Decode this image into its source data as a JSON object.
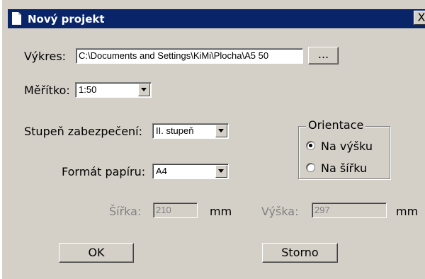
{
  "window": {
    "title": "Nový projekt",
    "close_glyph": "X"
  },
  "drawing": {
    "label": "Výkres:",
    "value": "C:\\Documents and Settings\\KiMi\\Plocha\\A5 50",
    "browse_label": "..."
  },
  "scale": {
    "label": "Měřítko:",
    "value": "1:50"
  },
  "security": {
    "label": "Stupeň zabezpečení:",
    "value": "II. stupeň"
  },
  "paper": {
    "label": "Formát papíru:",
    "value": "A4"
  },
  "orientation": {
    "legend": "Orientace",
    "options": [
      {
        "label": "Na výšku",
        "selected": true
      },
      {
        "label": "Na šířku",
        "selected": false
      }
    ]
  },
  "width": {
    "label": "Šířka:",
    "value": "210",
    "unit": "mm"
  },
  "height": {
    "label": "Výška:",
    "value": "297",
    "unit": "mm"
  },
  "buttons": {
    "ok": "OK",
    "cancel": "Storno"
  },
  "colors": {
    "face": "#d4d0c8",
    "titlebar": "#0a246a",
    "disabled_text": "#808080"
  }
}
